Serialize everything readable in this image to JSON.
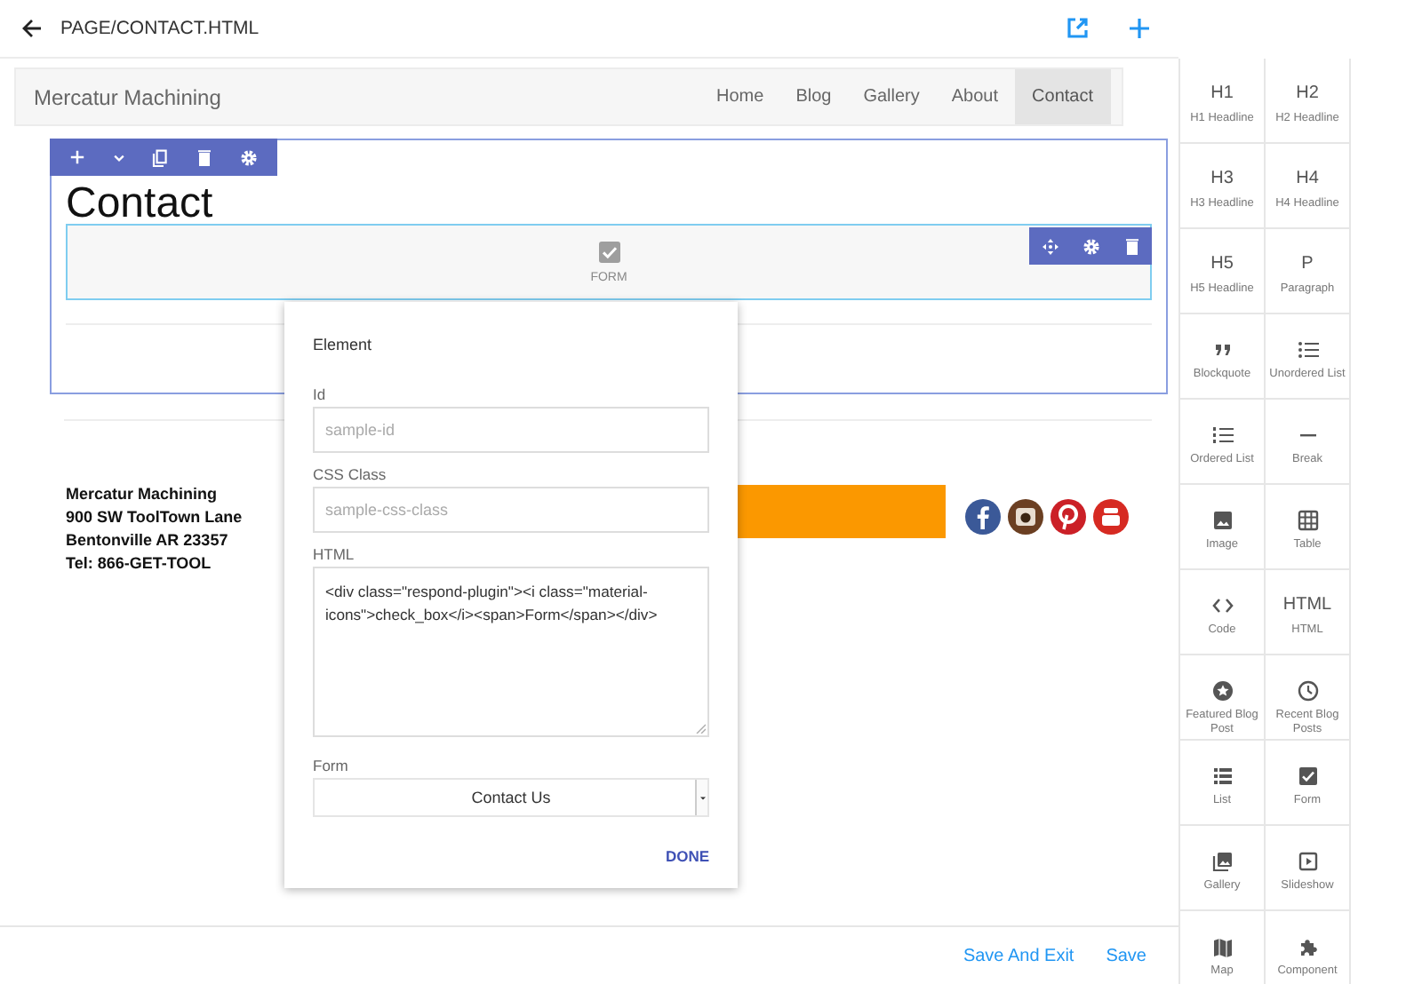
{
  "header": {
    "title": "PAGE/CONTACT.HTML"
  },
  "site": {
    "brand": "Mercatur Machining",
    "nav": [
      {
        "label": "Home",
        "selected": false
      },
      {
        "label": "Blog",
        "selected": false
      },
      {
        "label": "Gallery",
        "selected": false
      },
      {
        "label": "About",
        "selected": false
      },
      {
        "label": "Contact",
        "selected": true
      }
    ],
    "heading": "Contact",
    "form_block": {
      "label": "FORM"
    },
    "address": [
      "Mercatur Machining",
      "900 SW ToolTown Lane",
      "Bentonville AR 23357",
      "Tel: 866-GET-TOOL"
    ]
  },
  "dialog": {
    "title": "Element",
    "fields": [
      {
        "kind": "input",
        "label": "Id",
        "placeholder": "sample-id"
      },
      {
        "kind": "input",
        "label": "CSS Class",
        "placeholder": "sample-css-class"
      },
      {
        "kind": "textarea",
        "label": "HTML",
        "value": "<div class=\"respond-plugin\"><i class=\"material-icons\">check_box</i><span>Form</span></div>"
      },
      {
        "kind": "select",
        "label": "Form",
        "value": "Contact Us"
      }
    ],
    "done": "DONE"
  },
  "footer": {
    "buttons": [
      "Save And Exit",
      "Save"
    ]
  },
  "palette_rows": [
    [
      {
        "kind": "text",
        "glyph": "H1",
        "label": "H1 Headline"
      },
      {
        "kind": "text",
        "glyph": "H2",
        "label": "H2 Headline"
      }
    ],
    [
      {
        "kind": "text",
        "glyph": "H3",
        "label": "H3 Headline"
      },
      {
        "kind": "text",
        "glyph": "H4",
        "label": "H4 Headline"
      }
    ],
    [
      {
        "kind": "text",
        "glyph": "H5",
        "label": "H5 Headline"
      },
      {
        "kind": "text",
        "glyph": "P",
        "label": "Paragraph"
      }
    ],
    [
      {
        "kind": "quote",
        "label": "Blockquote"
      },
      {
        "kind": "bullets",
        "label": "Unordered List"
      }
    ],
    [
      {
        "kind": "numbers",
        "label": "Ordered List"
      },
      {
        "kind": "rule",
        "label": "Break"
      }
    ],
    [
      {
        "kind": "image",
        "label": "Image"
      },
      {
        "kind": "grid",
        "label": "Table"
      }
    ],
    [
      {
        "kind": "code",
        "label": "Code"
      },
      {
        "kind": "text",
        "glyph": "HTML",
        "label": "HTML"
      }
    ],
    [
      {
        "kind": "star",
        "label": "Featured Blog Post"
      },
      {
        "kind": "clock",
        "label": "Recent Blog Posts"
      }
    ],
    [
      {
        "kind": "list",
        "label": "List"
      },
      {
        "kind": "checkbox",
        "label": "Form"
      }
    ],
    [
      {
        "kind": "gallery",
        "label": "Gallery"
      },
      {
        "kind": "play",
        "label": "Slideshow"
      }
    ],
    [
      {
        "kind": "map",
        "label": "Map"
      },
      {
        "kind": "puzzle",
        "label": "Component"
      }
    ]
  ]
}
